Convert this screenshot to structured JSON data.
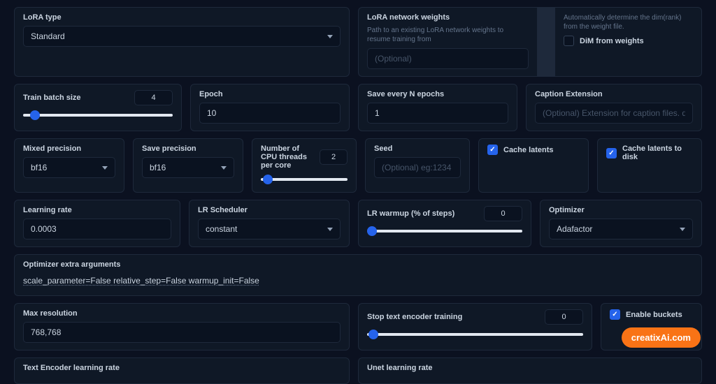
{
  "lora_type": {
    "label": "LoRA type",
    "value": "Standard"
  },
  "lora_weights": {
    "label": "LoRA network weights",
    "help": "Path to an existing LoRA network weights to resume training from",
    "placeholder": "(Optional)"
  },
  "dim_weights": {
    "help": "Automatically determine the dim(rank) from the weight file.",
    "label": "DiM from weights"
  },
  "train_batch": {
    "label": "Train batch size",
    "value": "4"
  },
  "epoch": {
    "label": "Epoch",
    "value": "10"
  },
  "save_n": {
    "label": "Save every N epochs",
    "value": "1"
  },
  "caption_ext": {
    "label": "Caption Extension",
    "placeholder": "(Optional) Extension for caption files. default: .caption"
  },
  "mixed_prec": {
    "label": "Mixed precision",
    "value": "bf16"
  },
  "save_prec": {
    "label": "Save precision",
    "value": "bf16"
  },
  "cpu_threads": {
    "label": "Number of CPU threads per core",
    "value": "2"
  },
  "seed": {
    "label": "Seed",
    "placeholder": "(Optional) eg:1234"
  },
  "cache_latents": {
    "label": "Cache latents"
  },
  "cache_latents_disk": {
    "label": "Cache latents to disk"
  },
  "lr": {
    "label": "Learning rate",
    "value": "0.0003"
  },
  "lr_sched": {
    "label": "LR Scheduler",
    "value": "constant"
  },
  "lr_warmup": {
    "label": "LR warmup (% of steps)",
    "value": "0"
  },
  "optimizer": {
    "label": "Optimizer",
    "value": "Adafactor"
  },
  "opt_args": {
    "label": "Optimizer extra arguments",
    "value": "scale_parameter=False relative_step=False warmup_init=False"
  },
  "max_res": {
    "label": "Max resolution",
    "value": "768,768"
  },
  "stop_te": {
    "label": "Stop text encoder training",
    "value": "0"
  },
  "enable_buckets": {
    "label": "Enable buckets"
  },
  "te_lr": {
    "label": "Text Encoder learning rate"
  },
  "unet_lr": {
    "label": "Unet learning rate"
  },
  "badge": "creatixAi.com"
}
